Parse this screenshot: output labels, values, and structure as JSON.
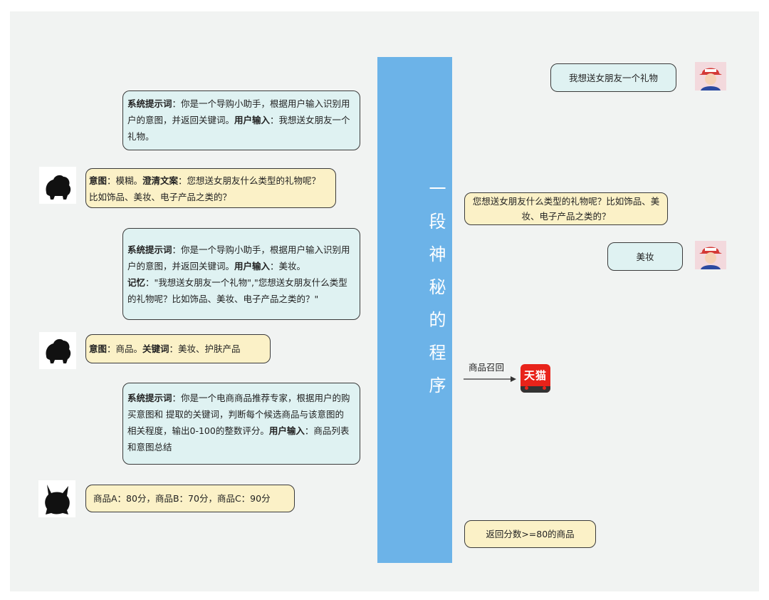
{
  "center_title": "一段神秘的程序",
  "left": {
    "sys1": {
      "label1": "系统提示词",
      "text1": "：你是一个导购小助手，根据用户输入识别用户的意图，并返回关键词。",
      "label2": "用户输入",
      "text2": "：我想送女朋友一个礼物。"
    },
    "reply1": {
      "label1": "意图",
      "text1": "：模糊。",
      "label2": "澄清文案",
      "text2": "：您想送女朋友什么类型的礼物呢？比如饰品、美妆、电子产品之类的？"
    },
    "sys2": {
      "label1": "系统提示词",
      "text1": "：你是一个导购小助手，根据用户输入识别用户的意图，并返回关键词。",
      "label2": "用户输入",
      "text2": "：美妆。",
      "label3": "记忆",
      "text3": "：\"我想送女朋友一个礼物\",\"您想送女朋友什么类型的礼物呢？比如饰品、美妆、电子产品之类的？\""
    },
    "reply2": {
      "label1": "意图",
      "text1": "：商品。",
      "label2": "关键词",
      "text2": "：美妆、护肤产品"
    },
    "sys3": {
      "label1": "系统提示词",
      "text1": "：你是一个电商商品推荐专家，根据用户的购买意图和  提取的关键词，判断每个候选商品与该意图的相关程度，输出0-100的整数评分。",
      "label2": "用户输入",
      "text2": "：商品列表和意图总结"
    },
    "reply3": "商品A：80分，商品B：70分，商品C：90分"
  },
  "right": {
    "user_msg1": "我想送女朋友一个礼物",
    "bot_msg": "您想送女朋友什么类型的礼物呢？比如饰品、美妆、电子产品之类的？",
    "user_msg2": "美妆",
    "recall_label": "商品召回",
    "tmall_logo_text": "天猫",
    "result": "返回分数>=80的商品"
  },
  "colors": {
    "bar": "#6cb3e8",
    "system_bubble": "#dff2f2",
    "reply_bubble": "#fbf1c7",
    "tmall": "#e8231a"
  },
  "icons": [
    "bulbasaur-silhouette-icon",
    "pikachu-silhouette-icon",
    "ash-avatar-icon",
    "tmall-logo-icon",
    "arrow-right-icon"
  ]
}
